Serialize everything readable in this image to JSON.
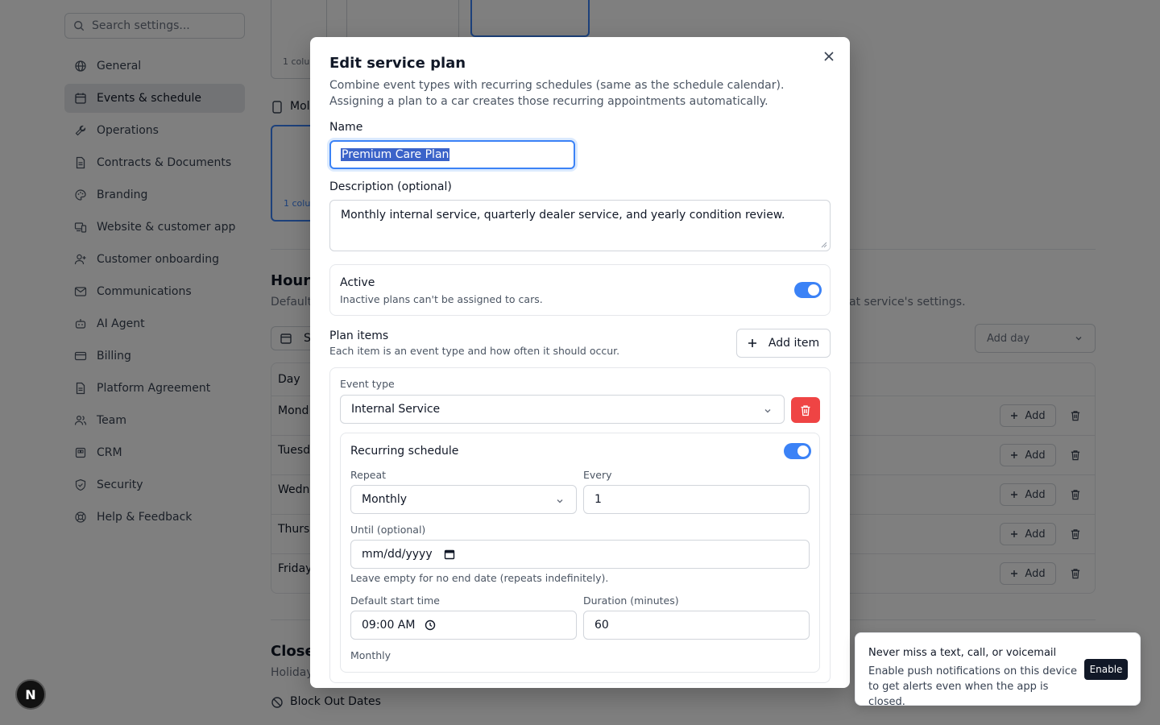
{
  "sidebar": {
    "search_placeholder": "Search settings...",
    "items": [
      {
        "label": "General",
        "icon": "globe-icon"
      },
      {
        "label": "Events & schedule",
        "icon": "calendar-icon",
        "active": true
      },
      {
        "label": "Operations",
        "icon": "wrench-icon"
      },
      {
        "label": "Contracts & Documents",
        "icon": "document-icon"
      },
      {
        "label": "Branding",
        "icon": "palette-icon"
      },
      {
        "label": "Website & customer app",
        "icon": "devices-icon"
      },
      {
        "label": "Customer onboarding",
        "icon": "user-plus-icon"
      },
      {
        "label": "Communications",
        "icon": "mail-icon"
      },
      {
        "label": "AI Agent",
        "icon": "robot-icon"
      },
      {
        "label": "Billing",
        "icon": "credit-card-icon"
      },
      {
        "label": "Platform Agreement",
        "icon": "document-icon"
      },
      {
        "label": "Team",
        "icon": "users-icon"
      },
      {
        "label": "CRM",
        "icon": "database-icon"
      },
      {
        "label": "Security",
        "icon": "shield-icon"
      },
      {
        "label": "Help & Feedback",
        "icon": "lifebuoy-icon"
      }
    ]
  },
  "background": {
    "thumb_caption": "1 colu",
    "mobile_label": "Mol",
    "hours_heading": "Hours",
    "hours_desc_left": "Default",
    "hours_desc_right": "at service's settings.",
    "schedule_btn": "S",
    "add_day": "Add day",
    "day_header": "Day",
    "days": [
      "Mond",
      "Tuesd",
      "Wedn",
      "Thurs",
      "Friday"
    ],
    "add_label": "Add",
    "closed_heading": "Close",
    "holiday_text": "Holiday",
    "block_out": "Block Out Dates"
  },
  "modal": {
    "title": "Edit service plan",
    "description": "Combine event types with recurring schedules (same as the schedule calendar). Assigning a plan to a car creates those recurring appointments automatically.",
    "name_label": "Name",
    "name_value": "Premium Care Plan",
    "description_label": "Description (optional)",
    "description_value": "Monthly internal service, quarterly dealer service, and yearly condition review.",
    "active_label": "Active",
    "active_hint": "Inactive plans can't be assigned to cars.",
    "active_on": true,
    "plan_items_label": "Plan items",
    "plan_items_hint": "Each item is an event type and how often it should occur.",
    "add_item": "Add item",
    "item": {
      "event_type_label": "Event type",
      "event_type_value": "Internal Service",
      "recurring_label": "Recurring schedule",
      "recurring_on": true,
      "repeat_label": "Repeat",
      "repeat_value": "Monthly",
      "every_label": "Every",
      "every_value": "1",
      "until_label": "Until (optional)",
      "until_placeholder": "mm/dd/yyyy",
      "until_hint": "Leave empty for no end date (repeats indefinitely).",
      "start_time_label": "Default start time",
      "start_time_value": "09:00 AM",
      "duration_label": "Duration (minutes)",
      "duration_value": "60",
      "summary": "Monthly"
    }
  },
  "toast": {
    "title": "Never miss a text, call, or voicemail",
    "body": "Enable push notifications on this device to get alerts even when the app is closed.",
    "button": "Enable"
  },
  "badge": "N",
  "colors": {
    "accent": "#3b82f6",
    "danger": "#ef4444",
    "overlay": "rgba(0,0,0,0.5)"
  }
}
